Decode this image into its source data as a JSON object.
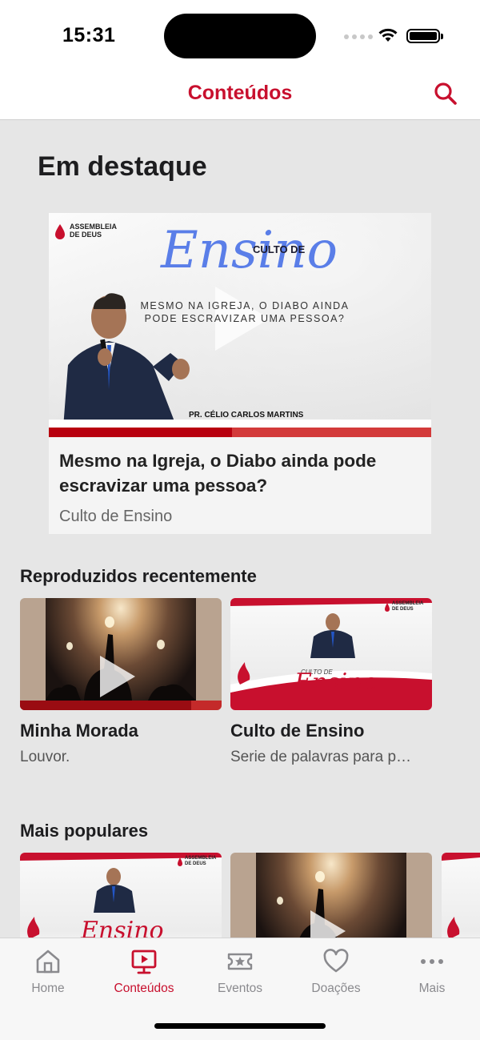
{
  "status_bar": {
    "time": "15:31"
  },
  "header": {
    "title": "Conteúdos",
    "search_icon": "search-icon"
  },
  "featured": {
    "section_title": "Em destaque",
    "progress": 0.48,
    "title": "Mesmo na Igreja, o Diabo ainda pode escravizar uma pessoa?",
    "subtitle": "Culto de Ensino",
    "thumbnail": {
      "brand": "ASSEMBLEIA DE DEUS",
      "culto_de": "CULTO DE",
      "ensino": "Ensino",
      "caption": "MESMO NA IGREJA, O DIABO AINDA PODE ESCRAVIZAR UMA PESSOA?",
      "speaker": "PR. CÉLIO CARLOS MARTINS"
    }
  },
  "recent": {
    "section_title": "Reproduzidos recentemente",
    "items": [
      {
        "title": "Minha Morada",
        "subtitle": "Louvor.",
        "progress": 0.85
      },
      {
        "title": "Culto de Ensino",
        "subtitle": "Serie de palavras para p…",
        "thumb_text": "Ensino",
        "thumb_small": "CULTO DE",
        "brand": "ASSEMBLEIA DE DEUS"
      }
    ]
  },
  "popular": {
    "section_title": "Mais populares",
    "items": [
      {
        "thumb_text": "Ensino",
        "brand": "ASSEMBLEIA DE DEUS"
      },
      {
        "thumb": "concert"
      },
      {
        "thumb": "ensino-partial"
      }
    ]
  },
  "tab_bar": {
    "tabs": [
      {
        "label": "Home",
        "icon": "home-icon",
        "active": false
      },
      {
        "label": "Conteúdos",
        "icon": "video-icon",
        "active": true
      },
      {
        "label": "Eventos",
        "icon": "ticket-icon",
        "active": false
      },
      {
        "label": "Doações",
        "icon": "heart-icon",
        "active": false
      },
      {
        "label": "Mais",
        "icon": "more-icon",
        "active": false
      }
    ]
  },
  "colors": {
    "accent": "#c8102e",
    "background": "#e6e6e6",
    "inactive": "#8a8a8e"
  }
}
